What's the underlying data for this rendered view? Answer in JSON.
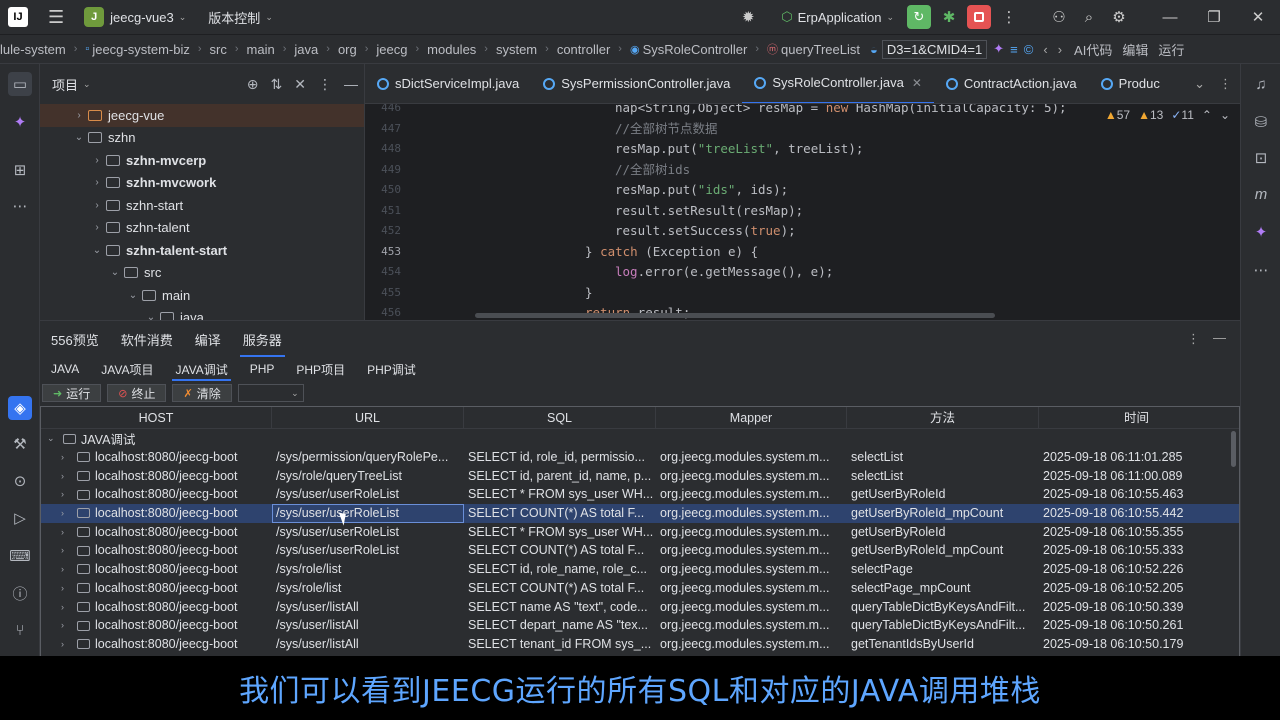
{
  "titlebar": {
    "logo": "IJ",
    "project_badge": "J",
    "project": "jeecg-vue3",
    "vcs": "版本控制",
    "run_config": "ErpApplication"
  },
  "breadcrumb": {
    "items": [
      "lule-system",
      "jeecg-system-biz",
      "src",
      "main",
      "java",
      "org",
      "jeecg",
      "modules",
      "system",
      "controller",
      "SysRoleController",
      "queryTreeList"
    ],
    "params": "D3=1&CMID4=1",
    "ai_code": "AI代码",
    "edit": "编辑",
    "run": "运行"
  },
  "project_panel": {
    "title": "项目",
    "tree": [
      {
        "label": "jeecg-vue",
        "level": 1,
        "open": false,
        "bold": false,
        "selected": true
      },
      {
        "label": "szhn",
        "level": 1,
        "open": true,
        "bold": false,
        "selected": false
      },
      {
        "label": "szhn-mvcerp",
        "level": 2,
        "open": false,
        "bold": true,
        "selected": false
      },
      {
        "label": "szhn-mvcwork",
        "level": 2,
        "open": false,
        "bold": true,
        "selected": false
      },
      {
        "label": "szhn-start",
        "level": 2,
        "open": false,
        "bold": false,
        "selected": false
      },
      {
        "label": "szhn-talent",
        "level": 2,
        "open": false,
        "bold": false,
        "selected": false
      },
      {
        "label": "szhn-talent-start",
        "level": 2,
        "open": true,
        "bold": true,
        "selected": false
      },
      {
        "label": "src",
        "level": 3,
        "open": true,
        "bold": false,
        "selected": false
      },
      {
        "label": "main",
        "level": 4,
        "open": true,
        "bold": false,
        "selected": false
      },
      {
        "label": "java",
        "level": 5,
        "open": true,
        "bold": false,
        "selected": false
      }
    ]
  },
  "editor": {
    "tabs": [
      "sDictServiceImpl.java",
      "SysPermissionController.java",
      "SysRoleController.java",
      "ContractAction.java",
      "Produc"
    ],
    "active_tab": "SysRoleController.java",
    "inspections": {
      "warnings": "57",
      "weak": "13",
      "typos": "11"
    },
    "lines": [
      {
        "no": "446",
        "code": "nap<String,Object> resMap = new HashMap(initialCapacity: 5);"
      },
      {
        "no": "447",
        "code": "//全部树节点数据"
      },
      {
        "no": "448",
        "code": "resMap.put(\"treeList\", treeList);"
      },
      {
        "no": "449",
        "code": "//全部树ids"
      },
      {
        "no": "450",
        "code": "resMap.put(\"ids\", ids);"
      },
      {
        "no": "451",
        "code": "result.setResult(resMap);"
      },
      {
        "no": "452",
        "code": "result.setSuccess(true);"
      },
      {
        "no": "453",
        "code": "} catch (Exception e) {"
      },
      {
        "no": "454",
        "code": "log.error(e.getMessage(), e);"
      },
      {
        "no": "455",
        "code": "}"
      },
      {
        "no": "456",
        "code": "return result;"
      }
    ]
  },
  "bottom_panel": {
    "tabs": [
      "556预览",
      "软件消费",
      "编译",
      "服务器"
    ],
    "active_tab": "服务器",
    "sub_tabs": [
      "JAVA",
      "JAVA项目",
      "JAVA调试",
      "PHP",
      "PHP项目",
      "PHP调试"
    ],
    "active_sub_tab": "JAVA调试",
    "actions": {
      "run": "运行",
      "stop": "终止",
      "clear": "清除"
    },
    "table": {
      "columns": [
        "HOST",
        "URL",
        "SQL",
        "Mapper",
        "方法",
        "时间"
      ],
      "group": "JAVA调试",
      "rows": [
        [
          "localhost:8080/jeecg-boot",
          "/sys/permission/queryRolePe...",
          "SELECT id, role_id, permissio...",
          "org.jeecg.modules.system.m...",
          "selectList",
          "2025-09-18 06:11:01.285"
        ],
        [
          "localhost:8080/jeecg-boot",
          "/sys/role/queryTreeList",
          "SELECT id, parent_id, name, p...",
          "org.jeecg.modules.system.m...",
          "selectList",
          "2025-09-18 06:11:00.089"
        ],
        [
          "localhost:8080/jeecg-boot",
          "/sys/user/userRoleList",
          "SELECT * FROM sys_user WH...",
          "org.jeecg.modules.system.m...",
          "getUserByRoleId",
          "2025-09-18 06:10:55.463"
        ],
        [
          "localhost:8080/jeecg-boot",
          "/sys/user/userRoleList",
          "SELECT COUNT(*) AS total F...",
          "org.jeecg.modules.system.m...",
          "getUserByRoleId_mpCount",
          "2025-09-18 06:10:55.442"
        ],
        [
          "localhost:8080/jeecg-boot",
          "/sys/user/userRoleList",
          "SELECT * FROM sys_user WH...",
          "org.jeecg.modules.system.m...",
          "getUserByRoleId",
          "2025-09-18 06:10:55.355"
        ],
        [
          "localhost:8080/jeecg-boot",
          "/sys/user/userRoleList",
          "SELECT COUNT(*) AS total F...",
          "org.jeecg.modules.system.m...",
          "getUserByRoleId_mpCount",
          "2025-09-18 06:10:55.333"
        ],
        [
          "localhost:8080/jeecg-boot",
          "/sys/role/list",
          "SELECT id, role_name, role_c...",
          "org.jeecg.modules.system.m...",
          "selectPage",
          "2025-09-18 06:10:52.226"
        ],
        [
          "localhost:8080/jeecg-boot",
          "/sys/role/list",
          "SELECT COUNT(*) AS total F...",
          "org.jeecg.modules.system.m...",
          "selectPage_mpCount",
          "2025-09-18 06:10:52.205"
        ],
        [
          "localhost:8080/jeecg-boot",
          "/sys/user/listAll",
          "SELECT name AS \"text\", code...",
          "org.jeecg.modules.system.m...",
          "queryTableDictByKeysAndFilt...",
          "2025-09-18 06:10:50.339"
        ],
        [
          "localhost:8080/jeecg-boot",
          "/sys/user/listAll",
          "SELECT depart_name AS \"tex...",
          "org.jeecg.modules.system.m...",
          "queryTableDictByKeysAndFilt...",
          "2025-09-18 06:10:50.261"
        ],
        [
          "localhost:8080/jeecg-boot",
          "/sys/user/listAll",
          "SELECT tenant_id FROM sys_...",
          "org.jeecg.modules.system.m...",
          "getTenantIdsByUserId",
          "2025-09-18 06:10:50.179"
        ]
      ],
      "selected_row": 3
    }
  },
  "subtitle": "我们可以看到JEECG运行的所有SQL和对应的JAVA调用堆栈",
  "colors": {
    "accent": "#3574f0",
    "subtitle": "#5ea6ff",
    "selection": "#2e436e"
  }
}
